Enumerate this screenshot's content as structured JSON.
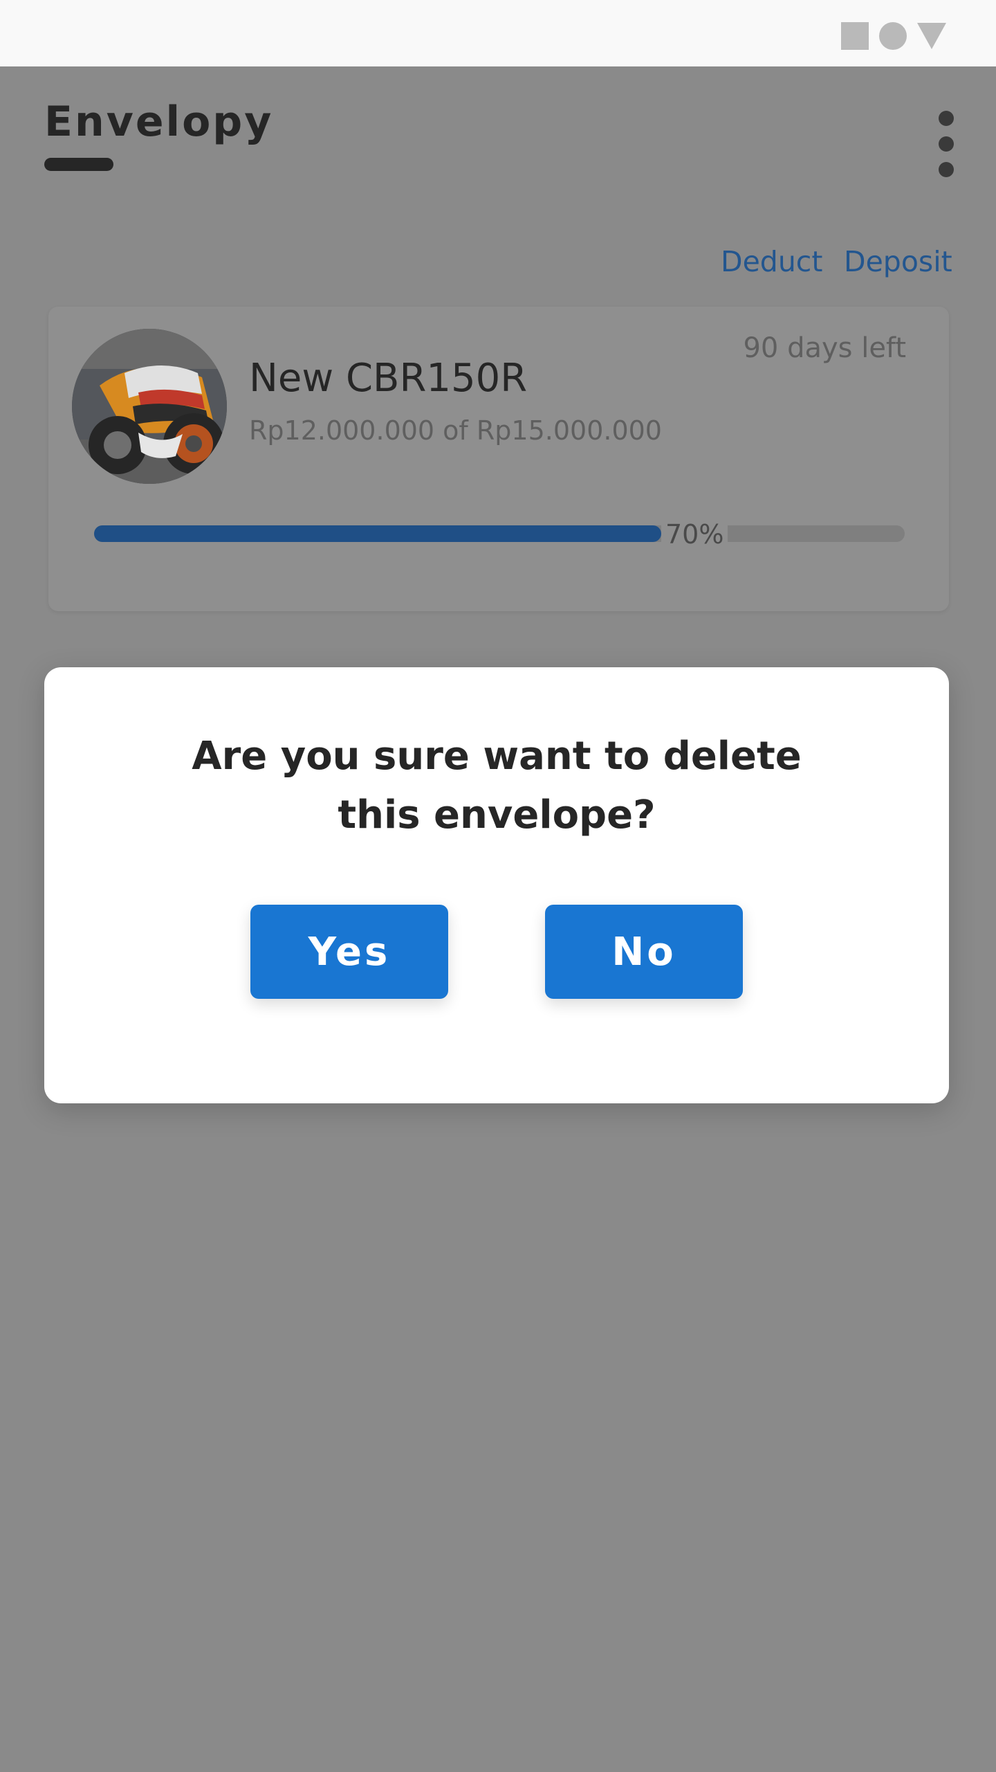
{
  "status_bar": {
    "icons": [
      "square-icon",
      "circle-icon",
      "triangle-icon"
    ]
  },
  "header": {
    "title": "Envelopy",
    "menu_icon": "more-vertical-icon"
  },
  "actions": {
    "deduct_label": "Deduct",
    "deposit_label": "Deposit"
  },
  "envelope": {
    "name": "New CBR150R",
    "amount_text": "Rp12.000.000 of Rp15.000.000",
    "deadline_text": "90 days left",
    "progress_fraction": 0.7,
    "progress_label": "70%"
  },
  "dialog": {
    "message_line1": "Are you sure want to delete",
    "message_line2": "this envelope?",
    "yes_label": "Yes",
    "no_label": "No"
  },
  "colors": {
    "overlay": "#8a8a8a",
    "primary": "#1976d2",
    "link": "#23568f",
    "progress_fill": "#1f4f86"
  }
}
